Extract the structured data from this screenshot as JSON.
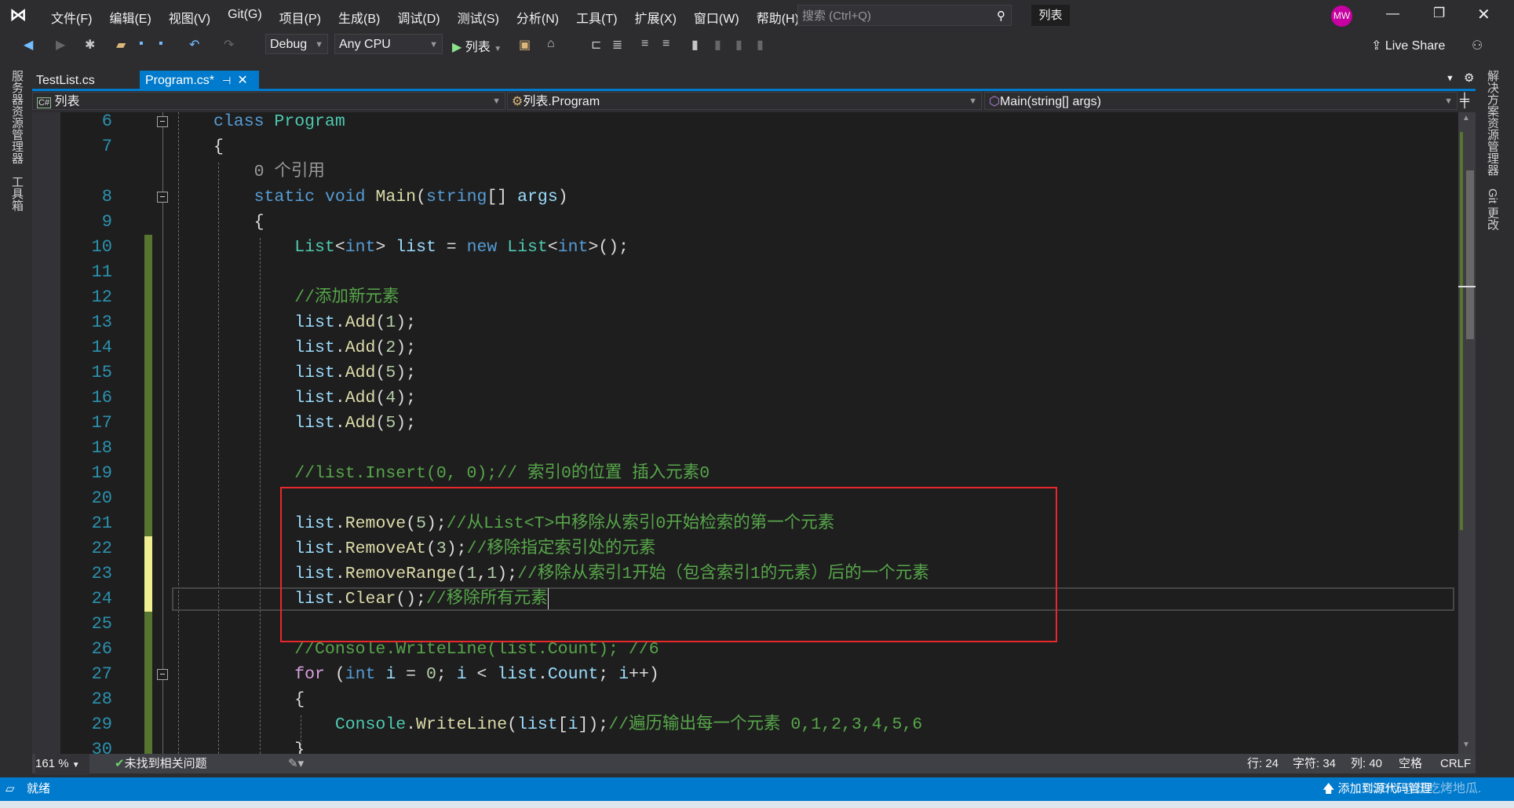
{
  "titlebar": {
    "menu": [
      "文件(F)",
      "编辑(E)",
      "视图(V)",
      "Git(G)",
      "项目(P)",
      "生成(B)",
      "调试(D)",
      "测试(S)",
      "分析(N)",
      "工具(T)",
      "扩展(X)",
      "窗口(W)",
      "帮助(H)"
    ],
    "search_placeholder": "搜索 (Ctrl+Q)",
    "solution_name": "列表",
    "avatar_initials": "MW",
    "avatar_color": "#c800a1"
  },
  "toolbar": {
    "config": "Debug",
    "platform": "Any CPU",
    "run_label": "列表",
    "live_share": "Live Share"
  },
  "side_left": [
    "服务器资源管理器",
    "工具箱"
  ],
  "side_right": [
    "解决方案资源管理器",
    "Git 更改"
  ],
  "tabs": [
    {
      "label": "TestList.cs",
      "active": false
    },
    {
      "label": "Program.cs*",
      "active": true
    }
  ],
  "navbar": {
    "project": "列表",
    "class": "列表.Program",
    "member": "Main(string[] args)"
  },
  "colors": {
    "accent": "#007acc",
    "saved_change": "#577430",
    "unsaved_change": "#efef91",
    "highlight_box": "#e8282b"
  },
  "code": [
    {
      "n": "6",
      "fold": true,
      "t": [
        [
          "kw",
          "class"
        ],
        [
          "pl",
          " "
        ],
        [
          "ty",
          "Program"
        ]
      ]
    },
    {
      "n": "7",
      "t": [
        [
          "pl",
          "{"
        ]
      ]
    },
    {
      "n": "",
      "lens": true,
      "t": [
        [
          "lens",
          "    0 个引用"
        ]
      ]
    },
    {
      "n": "8",
      "fold": true,
      "t": [
        [
          "kw",
          "    static"
        ],
        [
          "pl",
          " "
        ],
        [
          "kw",
          "void"
        ],
        [
          "pl",
          " "
        ],
        [
          "fn",
          "Main"
        ],
        [
          "pl",
          "("
        ],
        [
          "kw",
          "string"
        ],
        [
          "pl",
          "[] "
        ],
        [
          "var",
          "args"
        ],
        [
          "pl",
          ")"
        ]
      ]
    },
    {
      "n": "9",
      "t": [
        [
          "pl",
          "    {"
        ]
      ]
    },
    {
      "n": "10",
      "chg": "saved",
      "t": [
        [
          "ty",
          "        List"
        ],
        [
          "pl",
          "<"
        ],
        [
          "kw",
          "int"
        ],
        [
          "pl",
          "> "
        ],
        [
          "var",
          "list"
        ],
        [
          "pl",
          " = "
        ],
        [
          "kw",
          "new"
        ],
        [
          "pl",
          " "
        ],
        [
          "ty",
          "List"
        ],
        [
          "pl",
          "<"
        ],
        [
          "kw",
          "int"
        ],
        [
          "pl",
          ">();"
        ]
      ]
    },
    {
      "n": "11",
      "chg": "saved",
      "t": []
    },
    {
      "n": "12",
      "chg": "saved",
      "t": [
        [
          "cm",
          "        //添加新元素"
        ]
      ]
    },
    {
      "n": "13",
      "chg": "saved",
      "t": [
        [
          "var",
          "        list"
        ],
        [
          "pl",
          "."
        ],
        [
          "fn",
          "Add"
        ],
        [
          "pl",
          "("
        ],
        [
          "num",
          "1"
        ],
        [
          "pl",
          ");"
        ]
      ]
    },
    {
      "n": "14",
      "chg": "saved",
      "t": [
        [
          "var",
          "        list"
        ],
        [
          "pl",
          "."
        ],
        [
          "fn",
          "Add"
        ],
        [
          "pl",
          "("
        ],
        [
          "num",
          "2"
        ],
        [
          "pl",
          ");"
        ]
      ]
    },
    {
      "n": "15",
      "chg": "saved",
      "t": [
        [
          "var",
          "        list"
        ],
        [
          "pl",
          "."
        ],
        [
          "fn",
          "Add"
        ],
        [
          "pl",
          "("
        ],
        [
          "num",
          "5"
        ],
        [
          "pl",
          ");"
        ]
      ]
    },
    {
      "n": "16",
      "chg": "saved",
      "t": [
        [
          "var",
          "        list"
        ],
        [
          "pl",
          "."
        ],
        [
          "fn",
          "Add"
        ],
        [
          "pl",
          "("
        ],
        [
          "num",
          "4"
        ],
        [
          "pl",
          ");"
        ]
      ]
    },
    {
      "n": "17",
      "chg": "saved",
      "t": [
        [
          "var",
          "        list"
        ],
        [
          "pl",
          "."
        ],
        [
          "fn",
          "Add"
        ],
        [
          "pl",
          "("
        ],
        [
          "num",
          "5"
        ],
        [
          "pl",
          ");"
        ]
      ]
    },
    {
      "n": "18",
      "chg": "saved",
      "t": []
    },
    {
      "n": "19",
      "chg": "saved",
      "t": [
        [
          "cm",
          "        //list.Insert(0, 0);// 索引0的位置 插入元素0"
        ]
      ]
    },
    {
      "n": "20",
      "chg": "saved",
      "t": []
    },
    {
      "n": "21",
      "chg": "saved",
      "t": [
        [
          "var",
          "        list"
        ],
        [
          "pl",
          "."
        ],
        [
          "fn",
          "Remove"
        ],
        [
          "pl",
          "("
        ],
        [
          "num",
          "5"
        ],
        [
          "pl",
          ");"
        ],
        [
          "cm",
          "//从List<T>中移除从索引0开始检索的第一个元素"
        ]
      ]
    },
    {
      "n": "22",
      "chg": "unsaved",
      "t": [
        [
          "var",
          "        list"
        ],
        [
          "pl",
          "."
        ],
        [
          "fn",
          "RemoveAt"
        ],
        [
          "pl",
          "("
        ],
        [
          "num",
          "3"
        ],
        [
          "pl",
          ");"
        ],
        [
          "cm",
          "//移除指定索引处的元素"
        ]
      ]
    },
    {
      "n": "23",
      "chg": "unsaved",
      "t": [
        [
          "var",
          "        list"
        ],
        [
          "pl",
          "."
        ],
        [
          "fn",
          "RemoveRange"
        ],
        [
          "pl",
          "("
        ],
        [
          "num",
          "1"
        ],
        [
          "pl",
          ","
        ],
        [
          "num",
          "1"
        ],
        [
          "pl",
          ");"
        ],
        [
          "cm",
          "//移除从索引1开始（包含索引1的元素）后的一个元素"
        ]
      ]
    },
    {
      "n": "24",
      "chg": "unsaved",
      "current": true,
      "t": [
        [
          "var",
          "        list"
        ],
        [
          "pl",
          "."
        ],
        [
          "fn",
          "Clear"
        ],
        [
          "pl",
          "();"
        ],
        [
          "cm",
          "//移除所有元素"
        ]
      ]
    },
    {
      "n": "25",
      "chg": "saved",
      "t": []
    },
    {
      "n": "26",
      "chg": "saved",
      "t": [
        [
          "cm",
          "        //Console.WriteLine(list.Count); //6"
        ]
      ]
    },
    {
      "n": "27",
      "chg": "saved",
      "fold": true,
      "t": [
        [
          "ctl",
          "        for"
        ],
        [
          "pl",
          " ("
        ],
        [
          "kw",
          "int"
        ],
        [
          "pl",
          " "
        ],
        [
          "var",
          "i"
        ],
        [
          "pl",
          " = "
        ],
        [
          "num",
          "0"
        ],
        [
          "pl",
          "; "
        ],
        [
          "var",
          "i"
        ],
        [
          "pl",
          " < "
        ],
        [
          "var",
          "list"
        ],
        [
          "pl",
          "."
        ],
        [
          "var",
          "Count"
        ],
        [
          "pl",
          "; "
        ],
        [
          "var",
          "i"
        ],
        [
          "pl",
          "++)"
        ]
      ]
    },
    {
      "n": "28",
      "chg": "saved",
      "t": [
        [
          "pl",
          "        {"
        ]
      ]
    },
    {
      "n": "29",
      "chg": "saved",
      "t": [
        [
          "ty",
          "            Console"
        ],
        [
          "pl",
          "."
        ],
        [
          "fn",
          "WriteLine"
        ],
        [
          "pl",
          "("
        ],
        [
          "var",
          "list"
        ],
        [
          "pl",
          "["
        ],
        [
          "var",
          "i"
        ],
        [
          "pl",
          "]);"
        ],
        [
          "cm",
          "//遍历输出每一个元素 0,1,2,3,4,5,6"
        ]
      ]
    },
    {
      "n": "30",
      "chg": "saved",
      "t": [
        [
          "pl",
          "        }"
        ]
      ]
    }
  ],
  "editor_status": {
    "zoom": "161 %",
    "issues": "未找到相关问题",
    "line": "行: 24",
    "char": "字符: 34",
    "col": "列: 40",
    "indent": "空格",
    "eol": "CRLF"
  },
  "statusbar": {
    "ready": "就绪",
    "source_control": "添加到源代码管理",
    "watermark": "CSDN @想吃烤地瓜."
  }
}
